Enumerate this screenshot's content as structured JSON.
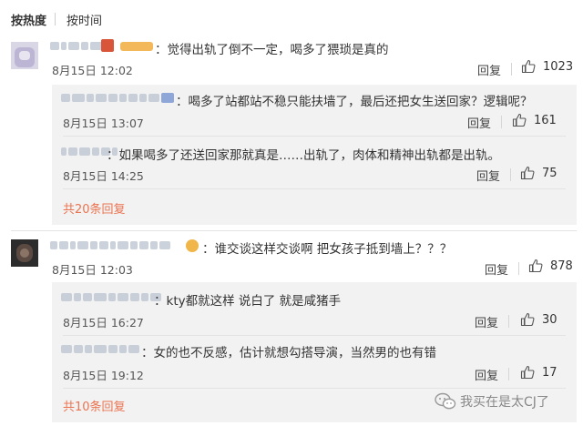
{
  "sort": {
    "hot_label": "按热度",
    "time_label": "按时间"
  },
  "reply_label": "回复",
  "comments": [
    {
      "text": "：觉得出轨了倒不一定，喝多了猥琐是真的",
      "time": "8月15日 12:02",
      "likes": "1023",
      "replies": [
        {
          "text": "：喝多了站都站不稳只能扶墙了，最后还把女生送回家？逻辑呢？",
          "time": "8月15日 13:07",
          "likes": "161"
        },
        {
          "text": "：如果喝多了还送回家那就真是……出轨了，肉体和精神出轨都是出轨。",
          "time": "8月15日 14:25",
          "likes": "75"
        }
      ],
      "more": "共20条回复"
    },
    {
      "text": "：谁交谈这样交谈啊 把女孩子抵到墙上？？？",
      "time": "8月15日 12:03",
      "likes": "878",
      "replies": [
        {
          "text": "：kty都就这样  说白了 就是咸猪手",
          "time": "8月15日 16:27",
          "likes": "30"
        },
        {
          "text": "：女的也不反感，估计就想勾搭导演，当然男的也有错",
          "time": "8月15日 19:12",
          "likes": "17"
        }
      ],
      "more": "共10条回复"
    }
  ],
  "watermark": "我买在是太CJ了",
  "colors": {
    "accent": "#eb7350",
    "sub_bg": "#f2f2f2"
  },
  "icons": {
    "like": "thumbs-up-icon",
    "watermark": "wechat-chat-icon"
  }
}
